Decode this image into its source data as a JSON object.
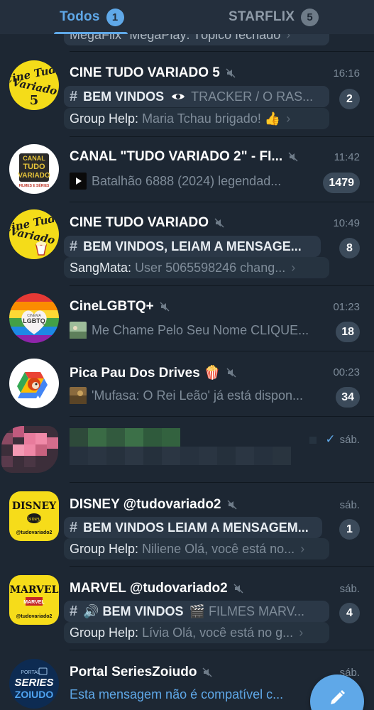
{
  "tabs": [
    {
      "label": "Todos",
      "count": "1"
    },
    {
      "label": "STARFLIX",
      "count": "5"
    }
  ],
  "top_partial": {
    "text": "MegaFlix \"MegaPlay: Tópico fechado"
  },
  "chats": [
    {
      "title": "CINE TUDO VARIADO 5",
      "time": "16:16",
      "topic": "BEM VINDOS",
      "topic_extra": "TRACKER / O RAS...",
      "sender": "Group Help:",
      "message": "Maria Tchau brigado! 👍",
      "unread": "2",
      "avatar_text": [
        "Cine Tudo",
        "Variado",
        "5"
      ]
    },
    {
      "title": "CANAL \"TUDO VARIADO 2\" - FI...",
      "time": "11:42",
      "preview": "Batalhão 6888 (2024) legendad...",
      "unread": "1479",
      "avatar_text": [
        "CANAL",
        "TUDO",
        "VARIADO",
        "FILMES E SÉRIES"
      ]
    },
    {
      "title": "CINE TUDO VARIADO",
      "time": "10:49",
      "topic": "BEM VINDOS, LEIAM A MENSAGE...",
      "sender": "SangMata:",
      "message": "User 5065598246 chang...",
      "unread": "8",
      "avatar_text": [
        "Cine Tudo",
        "Variado"
      ]
    },
    {
      "title": "CineLGBTQ+",
      "time": "01:23",
      "preview": "Me Chame Pelo Seu Nome CLIQUE...",
      "unread": "18",
      "avatar_text": [
        "CINEMA",
        "LGBTQ"
      ]
    },
    {
      "title": "Pica Pau Dos Drives 🍿",
      "time": "00:23",
      "preview": "'Mufasa: O Rei Leão' já está dispon...",
      "unread": "34"
    },
    {
      "title": "",
      "time": "sáb.",
      "check": "✓"
    },
    {
      "title": "DISNEY @tudovariado2",
      "time": "sáb.",
      "topic": "BEM VINDOS LEIAM A MENSAGEM...",
      "sender": "Group Help:",
      "message": "Niliene Olá, você está no...",
      "unread": "1",
      "avatar_text": [
        "DISNEY",
        "@tudovariado2"
      ]
    },
    {
      "title": "MARVEL @tudovariado2",
      "time": "sáb.",
      "topic": "🔊 BEM VINDOS",
      "topic_extra": "🎬 FILMES MARV...",
      "sender": "Group Help:",
      "message": "Lívia Olá, você está no g...",
      "unread": "4",
      "avatar_text": [
        "MARVEL",
        "@tudovariado2"
      ]
    },
    {
      "title": "Portal SeriesZoiudo",
      "time": "sáb.",
      "preview": "Esta mensagem não é compatível c...",
      "avatar_text": [
        "PORTAL",
        "SERIES",
        "ZOIUDO"
      ]
    }
  ],
  "fab": {
    "icon": "pencil-icon"
  },
  "colors": {
    "accent": "#5fa8e8",
    "background": "#1d2733",
    "badge": "#3b4a5a",
    "muted": "#7f8c99"
  }
}
